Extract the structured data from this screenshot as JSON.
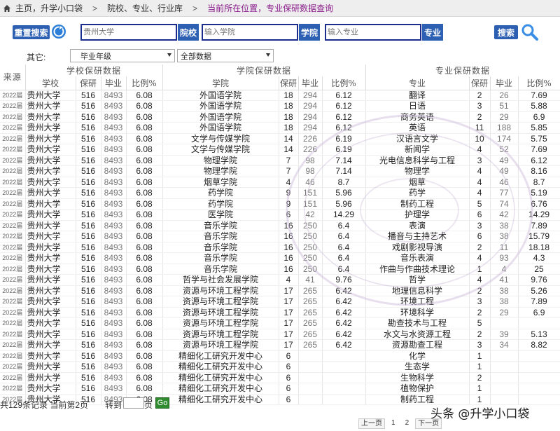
{
  "breadcrumb": {
    "items": [
      "主页，升学小口袋",
      "院校、专业、行业库"
    ],
    "separator": ">",
    "current": "当前所在位置，专业保研数据查询"
  },
  "toolbar": {
    "reset_label": "重置搜索",
    "school_placeholder": "贵州大学",
    "school_tag": "院校",
    "college_placeholder": "输入学院",
    "college_tag": "学院",
    "major_placeholder": "输入专业",
    "major_tag": "专业",
    "search_label": "搜索"
  },
  "filters": {
    "label": "其它:",
    "year_select": "毕业年级",
    "scope_select": "全部数据"
  },
  "table": {
    "source_header": "来源",
    "group_headers": [
      "学校保研数据",
      "学院保研数据",
      "专业保研数据"
    ],
    "sub_headers": [
      "学校",
      "保研",
      "毕业",
      "比例%",
      "学院",
      "保研",
      "毕业",
      "比例%",
      "专业",
      "保研",
      "毕业",
      "比例%"
    ],
    "rows": [
      [
        "2022届",
        "贵州大学",
        "516",
        "8493",
        "6.08",
        "外国语学院",
        "18",
        "294",
        "6.12",
        "翻译",
        "2",
        "26",
        "7.69"
      ],
      [
        "2022届",
        "贵州大学",
        "516",
        "8493",
        "6.08",
        "外国语学院",
        "18",
        "294",
        "6.12",
        "日语",
        "3",
        "51",
        "5.88"
      ],
      [
        "2022届",
        "贵州大学",
        "516",
        "8493",
        "6.08",
        "外国语学院",
        "18",
        "294",
        "6.12",
        "商务英语",
        "2",
        "29",
        "6.9"
      ],
      [
        "2022届",
        "贵州大学",
        "516",
        "8493",
        "6.08",
        "外国语学院",
        "18",
        "294",
        "6.12",
        "英语",
        "11",
        "188",
        "5.85"
      ],
      [
        "2022届",
        "贵州大学",
        "516",
        "8493",
        "6.08",
        "文学与传媒学院",
        "14",
        "226",
        "6.19",
        "汉语言文学",
        "10",
        "174",
        "5.75"
      ],
      [
        "2022届",
        "贵州大学",
        "516",
        "8493",
        "6.08",
        "文学与传媒学院",
        "14",
        "226",
        "6.19",
        "新闻学",
        "4",
        "52",
        "7.69"
      ],
      [
        "2022届",
        "贵州大学",
        "516",
        "8493",
        "6.08",
        "物理学院",
        "7",
        "98",
        "7.14",
        "光电信息科学与工程",
        "3",
        "49",
        "6.12"
      ],
      [
        "2022届",
        "贵州大学",
        "516",
        "8493",
        "6.08",
        "物理学院",
        "7",
        "98",
        "7.14",
        "物理学",
        "4",
        "49",
        "8.16"
      ],
      [
        "2022届",
        "贵州大学",
        "516",
        "8493",
        "6.08",
        "烟草学院",
        "4",
        "46",
        "8.7",
        "烟草",
        "4",
        "46",
        "8.7"
      ],
      [
        "2022届",
        "贵州大学",
        "516",
        "8493",
        "6.08",
        "药学院",
        "9",
        "151",
        "5.96",
        "药学",
        "4",
        "77",
        "5.19"
      ],
      [
        "2022届",
        "贵州大学",
        "516",
        "8493",
        "6.08",
        "药学院",
        "9",
        "151",
        "5.96",
        "制药工程",
        "5",
        "74",
        "6.76"
      ],
      [
        "2022届",
        "贵州大学",
        "516",
        "8493",
        "6.08",
        "医学院",
        "6",
        "42",
        "14.29",
        "护理学",
        "6",
        "42",
        "14.29"
      ],
      [
        "2022届",
        "贵州大学",
        "516",
        "8493",
        "6.08",
        "音乐学院",
        "16",
        "250",
        "6.4",
        "表演",
        "3",
        "38",
        "7.89"
      ],
      [
        "2022届",
        "贵州大学",
        "516",
        "8493",
        "6.08",
        "音乐学院",
        "16",
        "250",
        "6.4",
        "播音与主持艺术",
        "6",
        "38",
        "15.79"
      ],
      [
        "2022届",
        "贵州大学",
        "516",
        "8493",
        "6.08",
        "音乐学院",
        "16",
        "250",
        "6.4",
        "戏剧影视导演",
        "2",
        "11",
        "18.18"
      ],
      [
        "2022届",
        "贵州大学",
        "516",
        "8493",
        "6.08",
        "音乐学院",
        "16",
        "250",
        "6.4",
        "音乐表演",
        "4",
        "93",
        "4.3"
      ],
      [
        "2022届",
        "贵州大学",
        "516",
        "8493",
        "6.08",
        "音乐学院",
        "16",
        "250",
        "6.4",
        "作曲与作曲技术理论",
        "1",
        "4",
        "25"
      ],
      [
        "2022届",
        "贵州大学",
        "516",
        "8493",
        "6.08",
        "哲学与社会发展学院",
        "4",
        "41",
        "9.76",
        "哲学",
        "4",
        "41",
        "9.76"
      ],
      [
        "2022届",
        "贵州大学",
        "516",
        "8493",
        "6.08",
        "资源与环境工程学院",
        "17",
        "265",
        "6.42",
        "地理信息科学",
        "2",
        "38",
        "5.26"
      ],
      [
        "2022届",
        "贵州大学",
        "516",
        "8493",
        "6.08",
        "资源与环境工程学院",
        "17",
        "265",
        "6.42",
        "环境工程",
        "3",
        "38",
        "7.89"
      ],
      [
        "2022届",
        "贵州大学",
        "516",
        "8493",
        "6.08",
        "资源与环境工程学院",
        "17",
        "265",
        "6.42",
        "环境科学",
        "2",
        "29",
        "6.9"
      ],
      [
        "2022届",
        "贵州大学",
        "516",
        "8493",
        "6.08",
        "资源与环境工程学院",
        "17",
        "265",
        "6.42",
        "勘查技术与工程",
        "5",
        "",
        ""
      ],
      [
        "2022届",
        "贵州大学",
        "516",
        "8493",
        "6.08",
        "资源与环境工程学院",
        "17",
        "265",
        "6.42",
        "水文与水资源工程",
        "2",
        "39",
        "5.13"
      ],
      [
        "2022届",
        "贵州大学",
        "516",
        "8493",
        "6.08",
        "资源与环境工程学院",
        "17",
        "265",
        "6.42",
        "资源勘查工程",
        "3",
        "34",
        "8.82"
      ],
      [
        "2022届",
        "贵州大学",
        "516",
        "8493",
        "6.08",
        "精细化工研究开发中心",
        "6",
        "",
        "",
        "化学",
        "1",
        "",
        ""
      ],
      [
        "2022届",
        "贵州大学",
        "516",
        "8493",
        "6.08",
        "精细化工研究开发中心",
        "6",
        "",
        "",
        "生态学",
        "1",
        "",
        ""
      ],
      [
        "2022届",
        "贵州大学",
        "516",
        "8493",
        "6.08",
        "精细化工研究开发中心",
        "6",
        "",
        "",
        "生物科学",
        "2",
        "",
        ""
      ],
      [
        "2022届",
        "贵州大学",
        "516",
        "8493",
        "6.08",
        "精细化工研究开发中心",
        "6",
        "",
        "",
        "植物保护",
        "1",
        "",
        ""
      ],
      [
        "2022届",
        "贵州大学",
        "516",
        "8493",
        "6.08",
        "精细化工研究开发中心",
        "6",
        "",
        "",
        "制药工程",
        "1",
        "",
        ""
      ]
    ]
  },
  "footer": {
    "stats": "共129条记录  当前第2页",
    "goto_label": "转到",
    "page_unit": "页",
    "go_label": "Go"
  },
  "pager": {
    "prev": "上一页",
    "pages": [
      "1",
      "2"
    ],
    "next": "下一页"
  },
  "watermark": "头条 @升学小口袋",
  "colors": {
    "accent_blue": "#2d5fb3",
    "field_border": "#1a2d8c",
    "current_location": "#8a1a8a",
    "go_green": "#2e8b2e"
  }
}
